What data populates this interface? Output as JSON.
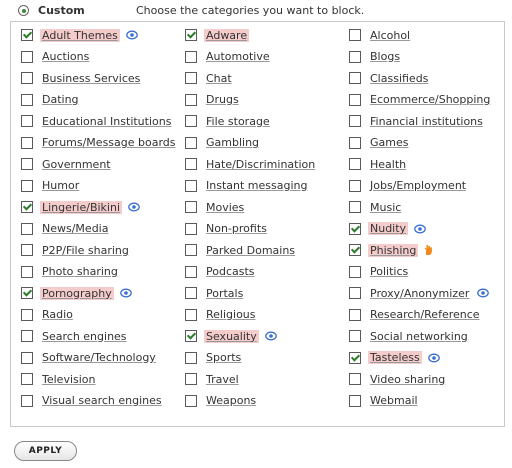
{
  "header": {
    "mode_label": "Custom",
    "instructions": "Choose the categories you want to block."
  },
  "categories": [
    {
      "label": "Adult Themes",
      "checked": true,
      "icon": "info-icon"
    },
    {
      "label": "Adware",
      "checked": true,
      "icon": null
    },
    {
      "label": "Alcohol",
      "checked": false,
      "icon": null
    },
    {
      "label": "Auctions",
      "checked": false,
      "icon": null
    },
    {
      "label": "Automotive",
      "checked": false,
      "icon": null
    },
    {
      "label": "Blogs",
      "checked": false,
      "icon": null
    },
    {
      "label": "Business Services",
      "checked": false,
      "icon": null
    },
    {
      "label": "Chat",
      "checked": false,
      "icon": null
    },
    {
      "label": "Classifieds",
      "checked": false,
      "icon": null
    },
    {
      "label": "Dating",
      "checked": false,
      "icon": null
    },
    {
      "label": "Drugs",
      "checked": false,
      "icon": null
    },
    {
      "label": "Ecommerce/Shopping",
      "checked": false,
      "icon": null
    },
    {
      "label": "Educational Institutions",
      "checked": false,
      "icon": null
    },
    {
      "label": "File storage",
      "checked": false,
      "icon": null
    },
    {
      "label": "Financial institutions",
      "checked": false,
      "icon": null
    },
    {
      "label": "Forums/Message boards",
      "checked": false,
      "icon": null
    },
    {
      "label": "Gambling",
      "checked": false,
      "icon": null
    },
    {
      "label": "Games",
      "checked": false,
      "icon": null
    },
    {
      "label": "Government",
      "checked": false,
      "icon": null
    },
    {
      "label": "Hate/Discrimination",
      "checked": false,
      "icon": null
    },
    {
      "label": "Health",
      "checked": false,
      "icon": null
    },
    {
      "label": "Humor",
      "checked": false,
      "icon": null
    },
    {
      "label": "Instant messaging",
      "checked": false,
      "icon": null
    },
    {
      "label": "Jobs/Employment",
      "checked": false,
      "icon": null
    },
    {
      "label": "Lingerie/Bikini",
      "checked": true,
      "icon": "info-icon"
    },
    {
      "label": "Movies",
      "checked": false,
      "icon": null
    },
    {
      "label": "Music",
      "checked": false,
      "icon": null
    },
    {
      "label": "News/Media",
      "checked": false,
      "icon": null
    },
    {
      "label": "Non-profits",
      "checked": false,
      "icon": null
    },
    {
      "label": "Nudity",
      "checked": true,
      "icon": "info-icon"
    },
    {
      "label": "P2P/File sharing",
      "checked": false,
      "icon": null
    },
    {
      "label": "Parked Domains",
      "checked": false,
      "icon": null
    },
    {
      "label": "Phishing",
      "checked": true,
      "icon": "hand-icon"
    },
    {
      "label": "Photo sharing",
      "checked": false,
      "icon": null
    },
    {
      "label": "Podcasts",
      "checked": false,
      "icon": null
    },
    {
      "label": "Politics",
      "checked": false,
      "icon": null
    },
    {
      "label": "Pornography",
      "checked": true,
      "icon": "info-icon"
    },
    {
      "label": "Portals",
      "checked": false,
      "icon": null
    },
    {
      "label": "Proxy/Anonymizer",
      "checked": false,
      "icon": "info-icon"
    },
    {
      "label": "Radio",
      "checked": false,
      "icon": null
    },
    {
      "label": "Religious",
      "checked": false,
      "icon": null
    },
    {
      "label": "Research/Reference",
      "checked": false,
      "icon": null
    },
    {
      "label": "Search engines",
      "checked": false,
      "icon": null
    },
    {
      "label": "Sexuality",
      "checked": true,
      "icon": "info-icon"
    },
    {
      "label": "Social networking",
      "checked": false,
      "icon": null
    },
    {
      "label": "Software/Technology",
      "checked": false,
      "icon": null
    },
    {
      "label": "Sports",
      "checked": false,
      "icon": null
    },
    {
      "label": "Tasteless",
      "checked": true,
      "icon": "info-icon"
    },
    {
      "label": "Television",
      "checked": false,
      "icon": null
    },
    {
      "label": "Travel",
      "checked": false,
      "icon": null
    },
    {
      "label": "Video sharing",
      "checked": false,
      "icon": null
    },
    {
      "label": "Visual search engines",
      "checked": false,
      "icon": null
    },
    {
      "label": "Weapons",
      "checked": false,
      "icon": null
    },
    {
      "label": "Webmail",
      "checked": false,
      "icon": null
    }
  ],
  "apply_label": "APPLY",
  "colors": {
    "checked_highlight": "#f5cccc",
    "check_mark": "#2d7d2d",
    "info_icon": "#3b6fd0",
    "hand_icon": "#f08a1c"
  }
}
